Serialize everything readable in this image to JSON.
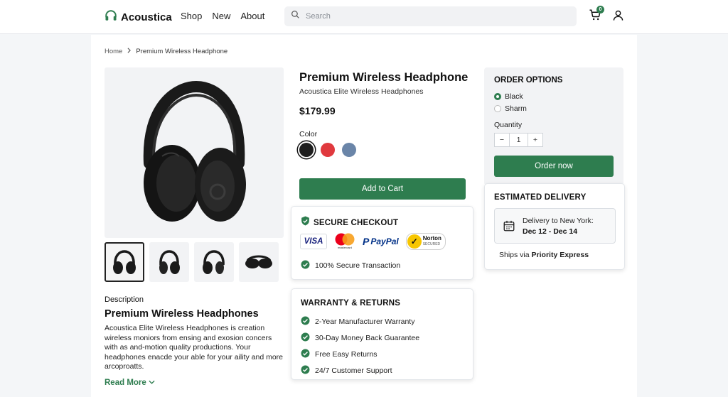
{
  "header": {
    "brand": "Acoustica",
    "nav": [
      "Shop",
      "New",
      "About"
    ],
    "search_placeholder": "Search",
    "cart_count": "0"
  },
  "breadcrumb": {
    "home": "Home",
    "current": "Premium Wireless Headphone"
  },
  "product": {
    "title": "Premium Wireless Headphone",
    "subtitle": "Acoustica Elite Wireless Headphones",
    "price": "$179.99",
    "color_label": "Color",
    "colors": [
      "#1e1e1e",
      "#e0393e",
      "#6a85a8"
    ],
    "selected_color": 0,
    "add_to_cart": "Add to Cart"
  },
  "description": {
    "label": "Description",
    "title": "Premium Wireless Headphones",
    "text": "Acoustica Elite Wireless Headphones is creation wireless moniors from ensing and exosion concers with as and-motion quality productions. Your headphones enacde your able for your aility and more arcoproatts.",
    "read_more": "Read More"
  },
  "secure_checkout": {
    "title": "SECURE CHECKOUT",
    "payments": [
      "VISA",
      "mastercard",
      "PayPal",
      "Norton",
      "SECURED"
    ],
    "item": "100% Secure Transaction"
  },
  "warranty": {
    "title": "WARRANTY & RETURNS",
    "items": [
      "2-Year Manufacturer Warranty",
      "30-Day Money Back Guarantee",
      "Free Easy Returns",
      "24/7 Customer Support"
    ]
  },
  "order_options": {
    "title": "ORDER OPTIONS",
    "options": [
      "Black",
      "Sharm"
    ],
    "selected": 0,
    "quantity_label": "Quantity",
    "minus": "−",
    "quantity": "1",
    "plus": "+",
    "order_button": "Order now"
  },
  "delivery": {
    "title": "ESTIMATED DELIVERY",
    "line1": "Delivery to New York:",
    "dates": "Dec 12 - Dec 14",
    "ships_prefix": "Ships via",
    "ships_method": "Priority Express"
  },
  "colors": {
    "accent": "#2e7d4f"
  }
}
